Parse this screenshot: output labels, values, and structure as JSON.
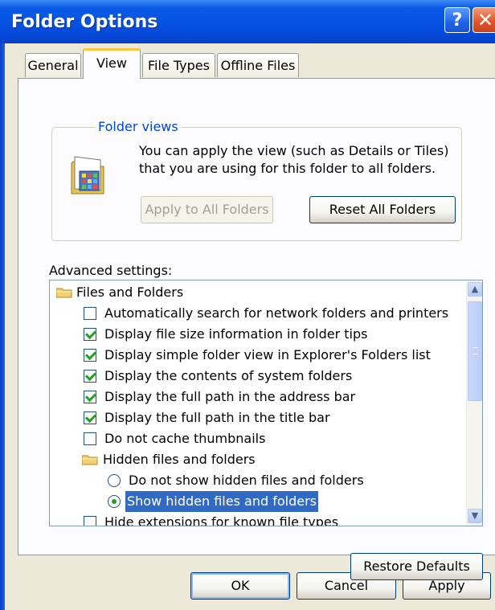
{
  "window": {
    "title": "Folder Options"
  },
  "tabs": [
    {
      "label": "General",
      "active": false
    },
    {
      "label": "View",
      "active": true
    },
    {
      "label": "File Types",
      "active": false
    },
    {
      "label": "Offline Files",
      "active": false
    }
  ],
  "folder_views": {
    "legend": "Folder views",
    "description": "You can apply the view (such as Details or Tiles) that you are using for this folder to all folders.",
    "apply_button": "Apply to All Folders",
    "reset_button": "Reset All Folders"
  },
  "advanced": {
    "label": "Advanced settings:",
    "items": [
      {
        "type": "folder",
        "label": "Files and Folders",
        "checked": null
      },
      {
        "type": "checkbox",
        "label": "Automatically search for network folders and printers",
        "checked": false
      },
      {
        "type": "checkbox",
        "label": "Display file size information in folder tips",
        "checked": true
      },
      {
        "type": "checkbox",
        "label": "Display simple folder view in Explorer's Folders list",
        "checked": true
      },
      {
        "type": "checkbox",
        "label": "Display the contents of system folders",
        "checked": true
      },
      {
        "type": "checkbox",
        "label": "Display the full path in the address bar",
        "checked": true
      },
      {
        "type": "checkbox",
        "label": "Display the full path in the title bar",
        "checked": true
      },
      {
        "type": "checkbox",
        "label": "Do not cache thumbnails",
        "checked": false
      },
      {
        "type": "folder",
        "label": "Hidden files and folders",
        "checked": null
      },
      {
        "type": "radio",
        "label": "Do not show hidden files and folders",
        "checked": false
      },
      {
        "type": "radio",
        "label": "Show hidden files and folders",
        "checked": true,
        "selected": true
      },
      {
        "type": "checkbox",
        "label": "Hide extensions for known file types",
        "checked": false
      }
    ]
  },
  "buttons": {
    "restore_defaults": "Restore Defaults",
    "ok": "OK",
    "cancel": "Cancel",
    "apply": "Apply"
  },
  "colors": {
    "titlebar": "#0652e0",
    "selection": "#316ac5",
    "check": "#21a121",
    "active_tab_accent": "#ffc83c",
    "dialog_face": "#ece9d8"
  }
}
